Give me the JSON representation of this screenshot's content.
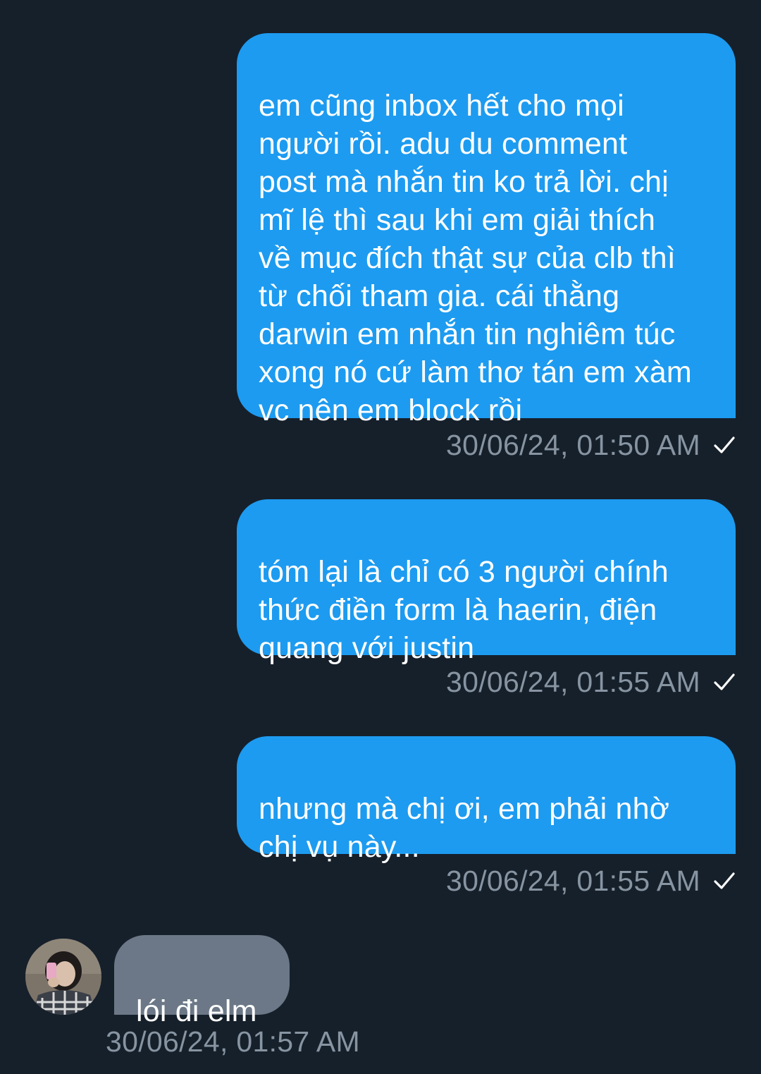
{
  "messages": [
    {
      "direction": "outgoing",
      "text": "em cũng inbox hết cho mọi\nngười rồi. adu du comment\npost mà nhắn tin ko trả lời. chị\nmĩ lệ thì sau khi em giải thích\nvề mục đích thật sự của clb thì\ntừ chối tham gia. cái thằng\ndarwin em nhắn tin nghiêm túc\nxong nó cứ làm thơ tán em xàm\nvc nên em block rồi",
      "timestamp": "30/06/24, 01:50 AM",
      "status_icon": "checkmark-icon"
    },
    {
      "direction": "outgoing",
      "text": "tóm lại là chỉ có 3 người chính\nthức điền form là haerin, điện\nquang với justin",
      "timestamp": "30/06/24, 01:55 AM",
      "status_icon": "checkmark-icon"
    },
    {
      "direction": "outgoing",
      "text": "nhưng mà chị ơi, em phải nhờ\nchị vụ này...",
      "timestamp": "30/06/24, 01:55 AM",
      "status_icon": "checkmark-icon"
    },
    {
      "direction": "incoming",
      "text": "lói đi elm",
      "timestamp": "30/06/24, 01:57 AM",
      "avatar": "contact-avatar"
    }
  ],
  "colors": {
    "background": "#16202b",
    "outgoing_bubble": "#1d9bf0",
    "incoming_bubble": "#6c7887",
    "timestamp": "#8794a1",
    "text": "#ffffff"
  }
}
